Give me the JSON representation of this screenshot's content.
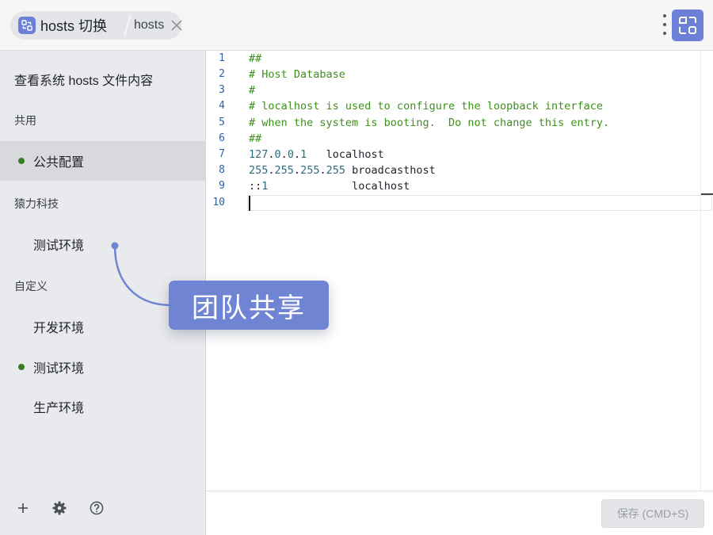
{
  "header": {
    "app_title": "hosts 切换",
    "file_tab": "hosts"
  },
  "sidebar": {
    "heading": "查看系统 hosts 文件内容",
    "groups": [
      {
        "label": "共用",
        "items": [
          {
            "label": "公共配置",
            "enabled": true,
            "selected": true
          }
        ]
      },
      {
        "label": "猿力科技",
        "items": [
          {
            "label": "测试环境",
            "enabled": false,
            "selected": false
          }
        ]
      },
      {
        "label": "自定义",
        "items": [
          {
            "label": "开发环境",
            "enabled": false,
            "selected": false
          },
          {
            "label": "测试环境",
            "enabled": true,
            "selected": false
          },
          {
            "label": "生产环境",
            "enabled": false,
            "selected": false
          }
        ]
      }
    ],
    "footer_icons": [
      "plus-icon",
      "gear-icon",
      "help-icon"
    ]
  },
  "editor": {
    "line_numbers": [
      "1",
      "2",
      "3",
      "4",
      "5",
      "6",
      "7",
      "8",
      "9",
      "10"
    ],
    "lines": [
      {
        "comment": "##"
      },
      {
        "comment": "# Host Database"
      },
      {
        "comment": "#"
      },
      {
        "comment": "# localhost is used to configure the loopback interface"
      },
      {
        "comment": "# when the system is booting.  Do not change this entry."
      },
      {
        "comment": "##"
      },
      {
        "ip_parts": [
          "127",
          "0",
          "0",
          "1"
        ],
        "gap": "   ",
        "host": "localhost"
      },
      {
        "ip_parts": [
          "255",
          "255",
          "255",
          "255"
        ],
        "gap": " ",
        "host": "broadcasthost"
      },
      {
        "ip_v6_sep": "::",
        "ip_v6_num": "1",
        "gap": "             ",
        "host": "localhost"
      },
      {
        "comment": ""
      }
    ],
    "active_line": 10
  },
  "bottombar": {
    "save_label": "保存 (CMD+S)"
  },
  "callout": {
    "label": "团队共享"
  },
  "colors": {
    "accent": "#6c80d8",
    "enabled_dot": "#3b7b26",
    "comment": "#3e8f1b",
    "line_number": "#2f63a8"
  }
}
